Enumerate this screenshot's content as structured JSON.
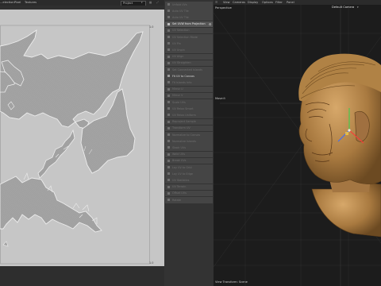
{
  "uv_editor": {
    "menu": [
      "...election",
      "Pixel",
      "Textures"
    ],
    "project_select": "Project",
    "corner_labels": {
      "top_right": "1.0",
      "bottom_right": "1.0"
    }
  },
  "tools": {
    "items": [
      {
        "label": "Unfold UVs",
        "state": "dim"
      },
      {
        "label": "Auto UV Tile",
        "state": "dim"
      },
      {
        "label": "Auto UV Tile",
        "state": "dim"
      },
      {
        "label": "Set UVW from Projection",
        "state": "active"
      },
      {
        "label": "UV Selection",
        "state": "dim"
      },
      {
        "label": "UV Selection Mode",
        "state": "dim"
      },
      {
        "label": "UV Pin",
        "state": "dim"
      },
      {
        "label": "UV Unpin",
        "state": "dim"
      },
      {
        "label": "UV Align",
        "state": "dim"
      },
      {
        "label": "UV Straighten",
        "state": "dim"
      },
      {
        "label": "Set Connected Islands",
        "state": "dim"
      },
      {
        "label": "Fit UV to Canvas",
        "state": "bright"
      },
      {
        "label": "Fit Islands Info",
        "state": "dim"
      },
      {
        "label": "Mirror U",
        "state": "dim"
      },
      {
        "label": "Mirror V",
        "state": "dim"
      },
      {
        "label": "Scale UVs",
        "state": "dim"
      },
      {
        "label": "UV Relax Smart",
        "state": "dim"
      },
      {
        "label": "UV Relax Uniform",
        "state": "dim"
      },
      {
        "label": "Reproject Sample",
        "state": "dim"
      },
      {
        "label": "Transform UV",
        "state": "dim"
      },
      {
        "label": "Normalize to Canvas",
        "state": "dim"
      },
      {
        "label": "Normalize Islands",
        "state": "dim"
      },
      {
        "label": "Stack UVs",
        "state": "dim"
      },
      {
        "label": "Weld UVs",
        "state": "dim"
      },
      {
        "label": "Break UVs",
        "state": "dim"
      },
      {
        "label": "Lay UV to Grid",
        "state": "dim"
      },
      {
        "label": "Lay UV to Edge",
        "state": "dim"
      },
      {
        "label": "UV Statistics",
        "state": "dim"
      },
      {
        "label": "UV Terrain",
        "state": "dim"
      },
      {
        "label": "Offset UVs",
        "state": "dim"
      },
      {
        "label": "Rotate",
        "state": "dim"
      }
    ]
  },
  "viewport": {
    "menu": [
      "View",
      "Cameras",
      "Display",
      "Options",
      "Filter",
      "Panel"
    ],
    "camera_label": "Default Camera",
    "view_name": "Perspective",
    "move_label": "Move",
    "status": "View Transform: Scene"
  },
  "colors": {
    "uv_background": "#c6c6c6",
    "uv_island_fill": "#a4a4a4",
    "bust_color": "#b58a4f",
    "viewport_bg": "#1c1c1c"
  }
}
